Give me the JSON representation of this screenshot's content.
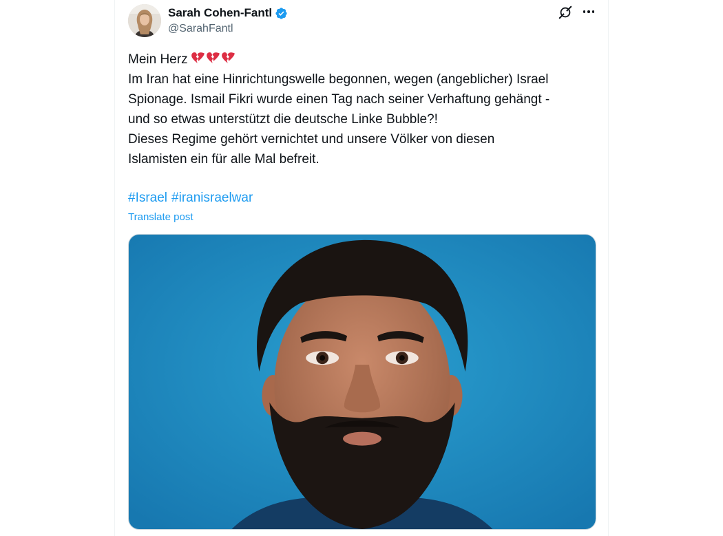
{
  "post": {
    "author": {
      "name": "Sarah Cohen-Fantl",
      "handle": "@SarahFantl",
      "avatar_icon": "profile-photo",
      "verified_icon": "verified-badge-icon",
      "verified_color": "#1d9bf0"
    },
    "actions": {
      "grok_icon": "grok-icon",
      "more_icon": "more-options-icon"
    },
    "text_lines": [
      "Mein Herz",
      "Im Iran hat eine Hinrichtungswelle begonnen, wegen (angeblicher) Israel",
      "Spionage. Ismail Fikri wurde einen Tag nach seiner Verhaftung gehängt -",
      "und so etwas unterstützt die deutsche Linke Bubble?!",
      "Dieses Regime gehört vernichtet und unsere Völker von diesen",
      "Islamisten ein für alle Mal befreit."
    ],
    "emoji": [
      "broken-heart",
      "broken-heart",
      "broken-heart"
    ],
    "hashtags": [
      "#Israel",
      "#iranisraelwar"
    ],
    "translate_label": "Translate post",
    "link_color": "#1d9bf0",
    "media_icon": "portrait-photo-blue-background"
  }
}
